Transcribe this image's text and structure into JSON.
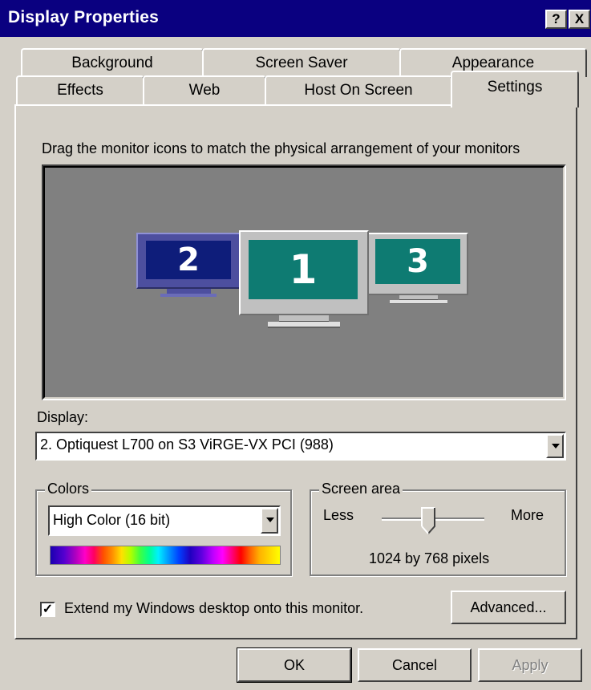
{
  "window": {
    "title": "Display Properties",
    "help_button": "?",
    "close_button": "X"
  },
  "tabs": {
    "back_row": [
      {
        "label": "Background"
      },
      {
        "label": "Screen Saver"
      },
      {
        "label": "Appearance"
      }
    ],
    "front_row": [
      {
        "label": "Effects"
      },
      {
        "label": "Web"
      },
      {
        "label": "Host On Screen"
      },
      {
        "label": "Settings"
      }
    ],
    "selected": "Settings"
  },
  "settings": {
    "hint": "Drag the monitor icons to match the physical arrangement of your monitors",
    "monitors": [
      {
        "number": "2",
        "screen_color": "#0e1d7a",
        "frame_color": "#4d4f9f"
      },
      {
        "number": "1",
        "screen_color": "#0e7b72",
        "frame_color": "#c0c0c0"
      },
      {
        "number": "3",
        "screen_color": "#0e7b72",
        "frame_color": "#c0c0c0"
      }
    ],
    "display_label": "Display:",
    "display_value": "2. Optiquest L700 on S3 ViRGE-VX PCI (988)",
    "colors": {
      "title": "Colors",
      "value": "High Color (16 bit)"
    },
    "screen_area": {
      "title": "Screen area",
      "less": "Less",
      "more": "More",
      "level_fraction": 0.45,
      "resolution": "1024 by 768 pixels"
    },
    "extend_checkbox": {
      "checked": true,
      "check_glyph": "✓",
      "label": "Extend my Windows desktop onto this monitor."
    },
    "advanced_button": "Advanced..."
  },
  "footer": {
    "ok": "OK",
    "cancel": "Cancel",
    "apply": "Apply"
  }
}
